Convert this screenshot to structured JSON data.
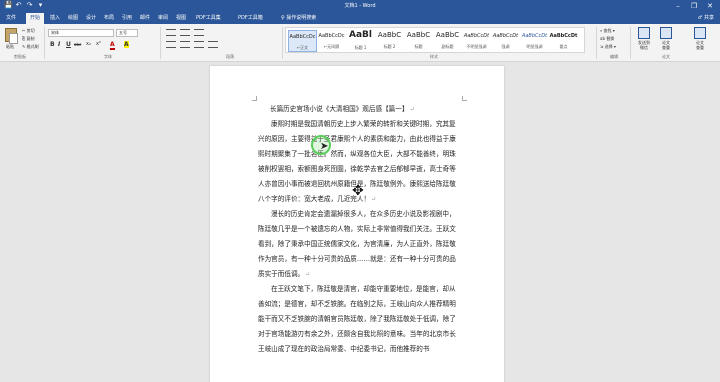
{
  "window": {
    "title": "文档1 - Word",
    "controls": [
      "–",
      "❐",
      "✕"
    ]
  },
  "qat": [
    "💾",
    "↶",
    "↷",
    "▾"
  ],
  "tabs": [
    "文件",
    "开始",
    "插入",
    "绘图",
    "设计",
    "布局",
    "引用",
    "邮件",
    "审阅",
    "视图",
    "PDF工具集",
    "PDF工具箱"
  ],
  "active_tab": "开始",
  "tell_me": "♀ 操作说明搜索",
  "share": "♂ 共享",
  "ribbon": {
    "clipboard": {
      "paste": "粘贴",
      "cut": "✂ 剪切",
      "copy": "⎘ 复制",
      "format_painter": "✎ 格式刷",
      "label": "剪贴板"
    },
    "font": {
      "name": "宋体",
      "size": "五号",
      "label": "字体",
      "buttons": [
        "B",
        "I",
        "U",
        "abc",
        "x₂",
        "x²",
        "A",
        "A"
      ]
    },
    "paragraph": {
      "label": "段落"
    },
    "styles": {
      "label": "样式",
      "items": [
        {
          "preview": "AaBbCcDc",
          "name": "↵正文",
          "kind": "sel"
        },
        {
          "preview": "AaBbCcDc",
          "name": "↵无间隔",
          "kind": ""
        },
        {
          "preview": "AaBl",
          "name": "标题 1",
          "kind": "big"
        },
        {
          "preview": "AaBbC",
          "name": "标题 2",
          "kind": "mid"
        },
        {
          "preview": "AaBbC",
          "name": "标题",
          "kind": "mid"
        },
        {
          "preview": "AaBbC",
          "name": "副标题",
          "kind": "mid"
        },
        {
          "preview": "AaBbCcDt",
          "name": "不明显强调",
          "kind": ""
        },
        {
          "preview": "AaBbCcDt",
          "name": "强调",
          "kind": ""
        },
        {
          "preview": "AaBbCcDt",
          "name": "明显强调",
          "kind": ""
        },
        {
          "preview": "AaBbCcDt",
          "name": "要点",
          "kind": ""
        }
      ]
    },
    "editing": {
      "label": "编辑",
      "find": "⌕ 查找 ▾",
      "replace": "ab 替换",
      "select": "⇲ 选择 ▾"
    },
    "big_buttons": [
      {
        "label": "发送到\n微信",
        "group": ""
      },
      {
        "label": "论文\n查重",
        "group": "论文"
      },
      {
        "label": "论文\n查重",
        "group": ""
      }
    ]
  },
  "document": {
    "title_line": "长篇历史官场小说《大清相国》观后感【篇一】",
    "paragraphs": [
      "康熙时期是我国清朝历史上步入繁荣的转折和关键时期，究其复兴的原因，主要得益于圣君康熙个人的素质和能力，由此也得益于康熙时期聚集了一批名臣。然而，纵观各位大臣，大部不能善终，明珠被削权罢相，索额图身死囹圄，徐乾学去官之后郁郁早逝，高士奇等人亦曾因小事而被退回杭州原籍但是，陈廷敬例外。康熙送给陈廷敬八个字的评价：宽大老成，几近完人！",
      "漫长的历史肯定会遗漏掉很多人，在众多历史小说及影视剧中，陈廷敬几乎是一个被遗忘的人物，实际上非常值得我们关注。王跃文看到，除了秉承中国正统儒家文化，为官清廉，为人正直外，陈廷敬作为官员，有一种十分可贵的品质……就是：还有一种十分可贵的品质实于而低调。",
      "在王跃文笔下，陈廷敬是清官，却能守重要地位，是能官，却从善如流；是德官，却不乏铁腕。在临别之际，王岐山向众人推荐精明能干而又不乏铁腕的清朝官员陈廷敬，除了我陈廷敬处于低调，除了对于官场能游刃有余之外，还颇含自我比照的意味。当年的北京市长王岐山成了现在的政治局常委、中纪委书记，而他推荐的书"
    ],
    "link_word": "却宅心"
  }
}
